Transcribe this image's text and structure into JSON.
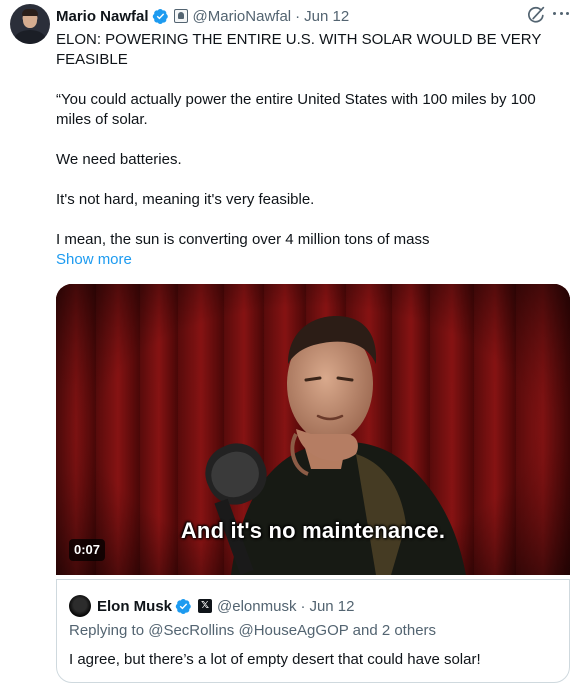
{
  "tweet": {
    "author_name": "Mario Nawfal",
    "author_handle": "@MarioNawfal",
    "separator": "·",
    "date": "Jun 12",
    "paragraphs": [
      "ELON: POWERING THE ENTIRE U.S. WITH SOLAR WOULD BE VERY FEASIBLE",
      "“You could actually power the entire United States with 100 miles by 100 miles of solar.",
      "We need batteries.",
      "It's not hard, meaning it's very feasible.",
      "I mean, the sun is converting over 4 million tons of mass"
    ],
    "show_more_label": "Show more"
  },
  "media": {
    "caption": "And it's no maintenance.",
    "duration": "0:07"
  },
  "quoted": {
    "author_name": "Elon Musk",
    "author_handle": "@elonmusk",
    "separator": "·",
    "date": "Jun 12",
    "badge_label": "𝕏",
    "reply_line": "Replying to @SecRollins @HouseAgGOP and 2 others",
    "text": "I agree, but there’s a lot of empty desert that could have solar!"
  },
  "colors": {
    "verified": "#1d9bf0",
    "link": "#1d9bf0",
    "secondary_text": "#536471",
    "border": "#cfd9de"
  },
  "icons": {
    "verified": "verified-badge-icon",
    "affiliate": "affiliate-badge-icon",
    "grok": "grok-icon",
    "more": "more-options-icon",
    "x_logo": "x-logo-icon"
  }
}
